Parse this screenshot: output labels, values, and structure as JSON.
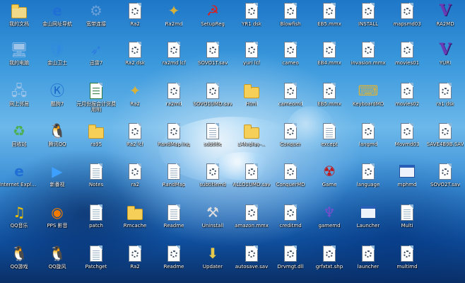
{
  "desktop": {
    "col0": [
      {
        "label": "我的文档",
        "icon": "my-documents-icon"
      },
      {
        "label": "我的电脑",
        "icon": "my-computer-icon"
      },
      {
        "label": "网上邻居",
        "icon": "network-places-icon"
      },
      {
        "label": "回收站",
        "icon": "recycle-bin-icon"
      },
      {
        "label": "Internet Explorer",
        "icon": "internet-explorer-icon"
      },
      {
        "label": "QQ音乐",
        "icon": "qq-music-icon"
      },
      {
        "label": "QQ游戏",
        "icon": "qq-game-icon"
      }
    ],
    "col1": [
      {
        "label": "金山网址导航",
        "icon": "kingsoft-nav-icon"
      },
      {
        "label": "金山卫士",
        "icon": "kingsoft-guard-icon"
      },
      {
        "label": "酷狗7",
        "icon": "kugou-icon"
      },
      {
        "label": "腾讯QQ",
        "icon": "tencent-qq-icon"
      },
      {
        "label": "新番视",
        "icon": "video-app-icon"
      },
      {
        "label": "PPS 影音",
        "icon": "pps-icon"
      },
      {
        "label": "QQ旋风",
        "icon": "qq-whirlwind-icon"
      }
    ],
    "col2": [
      {
        "label": "宽带连接",
        "icon": "broadband-connection-icon"
      },
      {
        "label": "迅雷7",
        "icon": "xunlei-icon"
      },
      {
        "label": "元月份报会计货费用明",
        "icon": "excel-file-icon"
      },
      {
        "label": "ra95",
        "icon": "folder-icon"
      },
      {
        "label": "Notes",
        "icon": "text-file-icon"
      },
      {
        "label": "patch",
        "icon": "word-file-icon"
      },
      {
        "label": "Patchget",
        "icon": "text-file-icon"
      }
    ],
    "col3": [
      {
        "label": "Ra2",
        "icon": "exe-file-icon"
      },
      {
        "label": "Ra2 dsk",
        "icon": "config-file-icon"
      },
      {
        "label": "Ra2",
        "icon": "ra2-app-icon"
      },
      {
        "label": "Ra2 lcf",
        "icon": "config-file-icon"
      },
      {
        "label": "ra2",
        "icon": "config-file-icon"
      },
      {
        "label": "Rmcache",
        "icon": "folder-icon"
      },
      {
        "label": "Ra2",
        "icon": "config-file-icon"
      }
    ],
    "col4": [
      {
        "label": "Ra2md",
        "icon": "ra2md-app-icon"
      },
      {
        "label": "ra2md lcf",
        "icon": "config-file-icon"
      },
      {
        "label": "ra2md",
        "icon": "config-file-icon"
      },
      {
        "label": "RandMap.ing",
        "icon": "config-file-icon"
      },
      {
        "label": "RandMap",
        "icon": "text-file-icon"
      },
      {
        "label": "Readme",
        "icon": "word-file-icon"
      },
      {
        "label": "Readme",
        "icon": "config-file-icon"
      }
    ],
    "col5": [
      {
        "label": "SetupReg",
        "icon": "setupreg-icon"
      },
      {
        "label": "SOVO1T.sav",
        "icon": "config-file-icon"
      },
      {
        "label": "SOVO1UMD.sav",
        "icon": "config-file-icon"
      },
      {
        "label": "subtitle",
        "icon": "text-file-icon"
      },
      {
        "label": "subtitlemd",
        "icon": "config-file-icon"
      },
      {
        "label": "Uninstall",
        "icon": "uninstall-icon"
      },
      {
        "label": "Updater",
        "icon": "updater-icon"
      }
    ],
    "col6": [
      {
        "label": "YR1 dsk",
        "icon": "config-file-icon"
      },
      {
        "label": "yuri lcf",
        "icon": "config-file-icon"
      },
      {
        "label": "Html",
        "icon": "folder-icon"
      },
      {
        "label": "LAN-play-...",
        "icon": "folder-icon"
      },
      {
        "label": "ALLO1UMD.sav",
        "icon": "config-file-icon"
      },
      {
        "label": "amazon.mmx",
        "icon": "config-file-icon"
      },
      {
        "label": "autosave.sav",
        "icon": "config-file-icon"
      }
    ],
    "col7": [
      {
        "label": "Blowfish",
        "icon": "config-file-icon"
      },
      {
        "label": "cameo",
        "icon": "config-file-icon"
      },
      {
        "label": "cameomd",
        "icon": "config-file-icon"
      },
      {
        "label": "Conquer",
        "icon": "config-file-icon"
      },
      {
        "label": "ConquerMD",
        "icon": "config-file-icon"
      },
      {
        "label": "creditmd",
        "icon": "config-file-icon"
      },
      {
        "label": "Drvmgt.dll",
        "icon": "dll-file-icon"
      }
    ],
    "col8": [
      {
        "label": "EB5.mmx",
        "icon": "config-file-icon"
      },
      {
        "label": "EB4.mmx",
        "icon": "config-file-icon"
      },
      {
        "label": "EB5.mmx",
        "icon": "config-file-icon"
      },
      {
        "label": "except",
        "icon": "text-file-icon"
      },
      {
        "label": "Game",
        "icon": "game-app-icon"
      },
      {
        "label": "gamemd",
        "icon": "gamemd-app-icon"
      },
      {
        "label": "grfxtxt.shp",
        "icon": "config-file-icon"
      }
    ],
    "col9": [
      {
        "label": "INSTALL",
        "icon": "config-file-icon"
      },
      {
        "label": "invasion.mmx",
        "icon": "config-file-icon"
      },
      {
        "label": "KeyboardMD",
        "icon": "keyboard-config-icon"
      },
      {
        "label": "langmd",
        "icon": "config-file-icon"
      },
      {
        "label": "language",
        "icon": "config-file-icon"
      },
      {
        "label": "Launcher",
        "icon": "launcher-app-icon"
      },
      {
        "label": "launcher",
        "icon": "config-file-icon"
      }
    ],
    "col10": [
      {
        "label": "mapsmd03",
        "icon": "config-file-icon"
      },
      {
        "label": "movies01",
        "icon": "config-file-icon"
      },
      {
        "label": "movies02",
        "icon": "config-file-icon"
      },
      {
        "label": "Movmd03",
        "icon": "config-file-icon"
      },
      {
        "label": "mphmd",
        "icon": "window-app-icon"
      },
      {
        "label": "Multi",
        "icon": "text-file-icon"
      },
      {
        "label": "multimd",
        "icon": "config-file-icon"
      }
    ],
    "col11": [
      {
        "label": "RA2MD",
        "icon": "ra2md-v-logo-icon"
      },
      {
        "label": "YURI",
        "icon": "yuri-v-logo-icon"
      },
      {
        "label": "ra1 dsk",
        "icon": "config-file-icon"
      },
      {
        "label": "SAVE4B9B.SAV",
        "icon": "config-file-icon"
      },
      {
        "label": "SOVO2T.sav",
        "icon": "config-file-icon"
      }
    ]
  }
}
